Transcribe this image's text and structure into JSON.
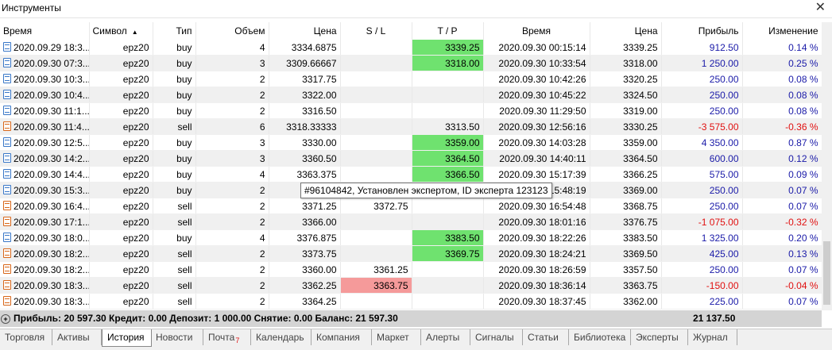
{
  "window": {
    "title": "Инструменты",
    "close_glyph": "✕"
  },
  "columns": [
    "Время",
    "Символ",
    "Тип",
    "Объем",
    "Цена",
    "S / L",
    "T / P",
    "Время",
    "Цена",
    "Прибыль",
    "Изменение"
  ],
  "sort_column": "Символ",
  "rows": [
    {
      "time": "2020.09.29 18:3...",
      "symbol": "epz20",
      "type": "buy",
      "volume": "4",
      "price": "3334.6875",
      "sl": "",
      "tp": "3339.25",
      "tp_hl": true,
      "sl_hl": false,
      "close_time": "2020.09.30 00:15:14",
      "close_price": "3339.25",
      "profit": "912.50",
      "change": "0.14 %",
      "neg": false
    },
    {
      "time": "2020.09.30 07:3...",
      "symbol": "epz20",
      "type": "buy",
      "volume": "3",
      "price": "3309.66667",
      "sl": "",
      "tp": "3318.00",
      "tp_hl": true,
      "sl_hl": false,
      "close_time": "2020.09.30 10:33:54",
      "close_price": "3318.00",
      "profit": "1 250.00",
      "change": "0.25 %",
      "neg": false
    },
    {
      "time": "2020.09.30 10:3...",
      "symbol": "epz20",
      "type": "buy",
      "volume": "2",
      "price": "3317.75",
      "sl": "",
      "tp": "",
      "tp_hl": false,
      "sl_hl": false,
      "close_time": "2020.09.30 10:42:26",
      "close_price": "3320.25",
      "profit": "250.00",
      "change": "0.08 %",
      "neg": false
    },
    {
      "time": "2020.09.30 10:4...",
      "symbol": "epz20",
      "type": "buy",
      "volume": "2",
      "price": "3322.00",
      "sl": "",
      "tp": "",
      "tp_hl": false,
      "sl_hl": false,
      "close_time": "2020.09.30 10:45:22",
      "close_price": "3324.50",
      "profit": "250.00",
      "change": "0.08 %",
      "neg": false
    },
    {
      "time": "2020.09.30 11:1...",
      "symbol": "epz20",
      "type": "buy",
      "volume": "2",
      "price": "3316.50",
      "sl": "",
      "tp": "",
      "tp_hl": false,
      "sl_hl": false,
      "close_time": "2020.09.30 11:29:50",
      "close_price": "3319.00",
      "profit": "250.00",
      "change": "0.08 %",
      "neg": false
    },
    {
      "time": "2020.09.30 11:4...",
      "symbol": "epz20",
      "type": "sell",
      "volume": "6",
      "price": "3318.33333",
      "sl": "",
      "tp": "3313.50",
      "tp_hl": false,
      "sl_hl": false,
      "close_time": "2020.09.30 12:56:16",
      "close_price": "3330.25",
      "profit": "-3 575.00",
      "change": "-0.36 %",
      "neg": true
    },
    {
      "time": "2020.09.30 12:5...",
      "symbol": "epz20",
      "type": "buy",
      "volume": "3",
      "price": "3330.00",
      "sl": "",
      "tp": "3359.00",
      "tp_hl": true,
      "sl_hl": false,
      "close_time": "2020.09.30 14:03:28",
      "close_price": "3359.00",
      "profit": "4 350.00",
      "change": "0.87 %",
      "neg": false
    },
    {
      "time": "2020.09.30 14:2...",
      "symbol": "epz20",
      "type": "buy",
      "volume": "3",
      "price": "3360.50",
      "sl": "",
      "tp": "3364.50",
      "tp_hl": true,
      "sl_hl": false,
      "close_time": "2020.09.30 14:40:11",
      "close_price": "3364.50",
      "profit": "600.00",
      "change": "0.12 %",
      "neg": false
    },
    {
      "time": "2020.09.30 14:4...",
      "symbol": "epz20",
      "type": "buy",
      "volume": "4",
      "price": "3363.375",
      "sl": "",
      "tp": "3366.50",
      "tp_hl": true,
      "sl_hl": false,
      "close_time": "2020.09.30 15:17:39",
      "close_price": "3366.25",
      "profit": "575.00",
      "change": "0.09 %",
      "neg": false
    },
    {
      "time": "2020.09.30 15:3...",
      "symbol": "epz20",
      "type": "buy",
      "volume": "2",
      "price": "",
      "sl": "",
      "tp": "",
      "tp_hl": false,
      "sl_hl": false,
      "close_time": "15:48:19",
      "close_price": "3369.00",
      "profit": "250.00",
      "change": "0.07 %",
      "neg": false
    },
    {
      "time": "2020.09.30 16:4...",
      "symbol": "epz20",
      "type": "sell",
      "volume": "2",
      "price": "3371.25",
      "sl": "3372.75",
      "tp": "",
      "tp_hl": false,
      "sl_hl": false,
      "close_time": "2020.09.30 16:54:48",
      "close_price": "3368.75",
      "profit": "250.00",
      "change": "0.07 %",
      "neg": false
    },
    {
      "time": "2020.09.30 17:1...",
      "symbol": "epz20",
      "type": "sell",
      "volume": "2",
      "price": "3366.00",
      "sl": "",
      "tp": "",
      "tp_hl": false,
      "sl_hl": false,
      "close_time": "2020.09.30 18:01:16",
      "close_price": "3376.75",
      "profit": "-1 075.00",
      "change": "-0.32 %",
      "neg": true
    },
    {
      "time": "2020.09.30 18:0...",
      "symbol": "epz20",
      "type": "buy",
      "volume": "4",
      "price": "3376.875",
      "sl": "",
      "tp": "3383.50",
      "tp_hl": true,
      "sl_hl": false,
      "close_time": "2020.09.30 18:22:26",
      "close_price": "3383.50",
      "profit": "1 325.00",
      "change": "0.20 %",
      "neg": false
    },
    {
      "time": "2020.09.30 18:2...",
      "symbol": "epz20",
      "type": "sell",
      "volume": "2",
      "price": "3373.75",
      "sl": "",
      "tp": "3369.75",
      "tp_hl": true,
      "sl_hl": false,
      "close_time": "2020.09.30 18:24:21",
      "close_price": "3369.50",
      "profit": "425.00",
      "change": "0.13 %",
      "neg": false
    },
    {
      "time": "2020.09.30 18:2...",
      "symbol": "epz20",
      "type": "sell",
      "volume": "2",
      "price": "3360.00",
      "sl": "3361.25",
      "tp": "",
      "tp_hl": false,
      "sl_hl": false,
      "close_time": "2020.09.30 18:26:59",
      "close_price": "3357.50",
      "profit": "250.00",
      "change": "0.07 %",
      "neg": false
    },
    {
      "time": "2020.09.30 18:3...",
      "symbol": "epz20",
      "type": "sell",
      "volume": "2",
      "price": "3362.25",
      "sl": "3363.75",
      "tp": "",
      "tp_hl": false,
      "sl_hl": true,
      "close_time": "2020.09.30 18:36:14",
      "close_price": "3363.75",
      "profit": "-150.00",
      "change": "-0.04 %",
      "neg": true
    },
    {
      "time": "2020.09.30 18:3...",
      "symbol": "epz20",
      "type": "sell",
      "volume": "2",
      "price": "3364.25",
      "sl": "",
      "tp": "",
      "tp_hl": false,
      "sl_hl": false,
      "close_time": "2020.09.30 18:37:45",
      "close_price": "3362.00",
      "profit": "225.00",
      "change": "0.07 %",
      "neg": false
    }
  ],
  "tooltip": "#96104842, Установлен экспертом, ID эксперта 123123",
  "summary": {
    "text": "Прибыль: 20 597.30  Кредит: 0.00  Депозит: 1 000.00  Снятие: 0.00  Баланс: 21 597.30",
    "total": "21 137.50",
    "icon_glyph": "+"
  },
  "tabs": [
    {
      "label": "Торговля",
      "active": false
    },
    {
      "label": "Активы",
      "active": false
    },
    {
      "label": "История",
      "active": true
    },
    {
      "label": "Новости",
      "active": false
    },
    {
      "label": "Почта",
      "active": false,
      "badge": "7"
    },
    {
      "label": "Календарь",
      "active": false
    },
    {
      "label": "Компания",
      "active": false
    },
    {
      "label": "Маркет",
      "active": false
    },
    {
      "label": "Алерты",
      "active": false
    },
    {
      "label": "Сигналы",
      "active": false
    },
    {
      "label": "Статьи",
      "active": false
    },
    {
      "label": "Библиотека",
      "active": false
    },
    {
      "label": "Эксперты",
      "active": false
    },
    {
      "label": "Журнал",
      "active": false
    }
  ],
  "colors": {
    "tp_highlight": "#6fe26f",
    "sl_highlight": "#f59a9a",
    "profit_pos": "#1a1aa8",
    "profit_neg": "#e01010",
    "buy_icon": "#3a78c8",
    "sell_icon": "#d8671a"
  }
}
